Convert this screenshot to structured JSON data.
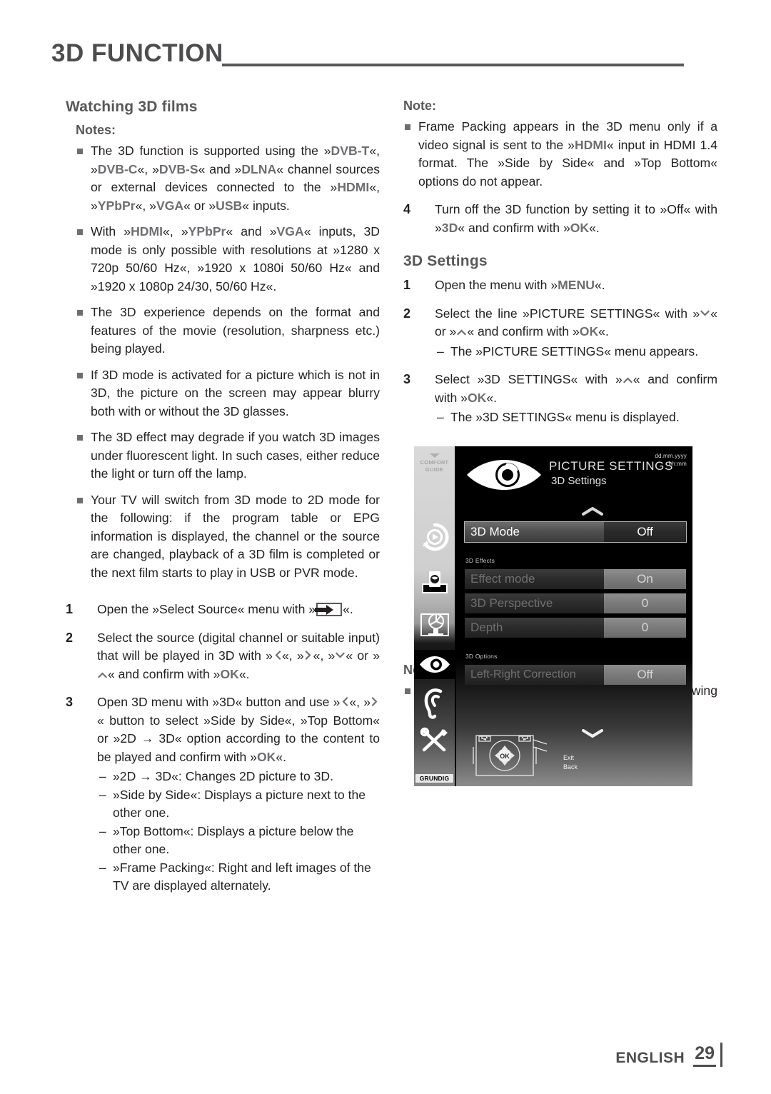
{
  "header": {
    "title": "3D FUNCTION"
  },
  "left": {
    "section_title": "Watching 3D films",
    "notes_label": "Notes:",
    "notes": [
      "The 3D function is supported using the »DVB-T«, »DVB-C«, »DVB-S« and »DLNA« channel sources or external devices connected to the »HDMI«, »YPbPr«, »VGA« or »USB« inputs.",
      "With »HDMI«, »YPbPr« and »VGA« inputs, 3D mode is only possible with resolutions at »1280 x 720p 50/60 Hz«, »1920 x 1080i 50/60 Hz« and »1920 x 1080p 24/30, 50/60 Hz«.",
      "The 3D experience depends on the format and features of the movie (resolution, sharpness etc.) being played.",
      "If 3D mode is activated for a picture which is not in 3D, the picture on the screen may appear blurry both with or without the 3D glasses.",
      "The 3D effect may degrade if you watch 3D images under fluorescent light. In such cases, either reduce the light or turn off the lamp.",
      "Your TV will switch from 3D mode to 2D mode for the following: if the program table or EPG information is displayed, the channel or the source are changed, playback of a 3D film is completed or the next film starts to play in USB or PVR mode."
    ],
    "steps": [
      {
        "num": "1",
        "text": "Open the »Select Source« menu with » «."
      },
      {
        "num": "2",
        "text": "Select the source (digital channel or suitable input) that will be played in 3D with »<«, »>«, »V« or »^« and confirm with »OK«."
      },
      {
        "num": "3",
        "text": "Open 3D menu with »3D« button and use »<«, »>« button to select »Side by Side«, »Top Bottom« or »2D → 3D« option according to the content to be played and confirm with »OK«."
      }
    ],
    "step3_sublist": [
      "»2D → 3D«: Changes 2D picture to 3D.",
      "»Side by Side«: Displays a picture next to the other one.",
      "»Top Bottom«: Displays a picture below the other one.",
      "»Frame Packing«: Right and left images of the TV are displayed alternately."
    ]
  },
  "right": {
    "note_label_top": "Note:",
    "note_top": "Frame Packing appears in the 3D menu only if a video signal is sent to the »HDMI« input in HDMI 1.4 format. The »Side by Side« and »Top Bottom« options do not appear.",
    "step4": {
      "num": "4",
      "text": "Turn off the 3D function by setting it to »Off« with »3D« and confirm with »OK«."
    },
    "section_title": "3D Settings",
    "steps": [
      {
        "num": "1",
        "text": "Open the menu with »MENU«."
      },
      {
        "num": "2",
        "text": "Select the line »PICTURE SETTINGS« with »V« or »^« and confirm with »OK«."
      },
      {
        "num": "3",
        "text": "Select »3D SETTINGS« with »^« and confirm with »OK«."
      }
    ],
    "step2_sub": "The »PICTURE SETTINGS« menu appears.",
    "step3_sub": "The »3D SETTINGS« menu is displayed.",
    "note_label_bottom": "Note:",
    "note_bottom": "Additional operations are explained in the following sections."
  },
  "tv_menu": {
    "comfort_guide": {
      "line1": "COMFORT",
      "line2": "GUIDE"
    },
    "brand": "GRUNDIG",
    "datetime": {
      "date": "dd.mm.yyyy",
      "time": "hh:mm"
    },
    "title": "PICTURE SETTINGS",
    "subtitle": "3D Settings",
    "group_effects": "3D Effects",
    "group_options": "3D Options",
    "rows": [
      {
        "label": "3D Mode",
        "value": "Off",
        "state": "selected"
      },
      {
        "label": "Effect mode",
        "value": "On",
        "state": "disabled"
      },
      {
        "label": "3D Perspective",
        "value": "0",
        "state": "disabled"
      },
      {
        "label": "Depth",
        "value": "0",
        "state": "disabled"
      },
      {
        "label": "Left-Right Correction",
        "value": "Off",
        "state": "disabled"
      }
    ],
    "legend": {
      "exit": "Exit",
      "back": "Back",
      "ok": "OK"
    }
  },
  "footer": {
    "language": "ENGLISH",
    "page": "29"
  }
}
